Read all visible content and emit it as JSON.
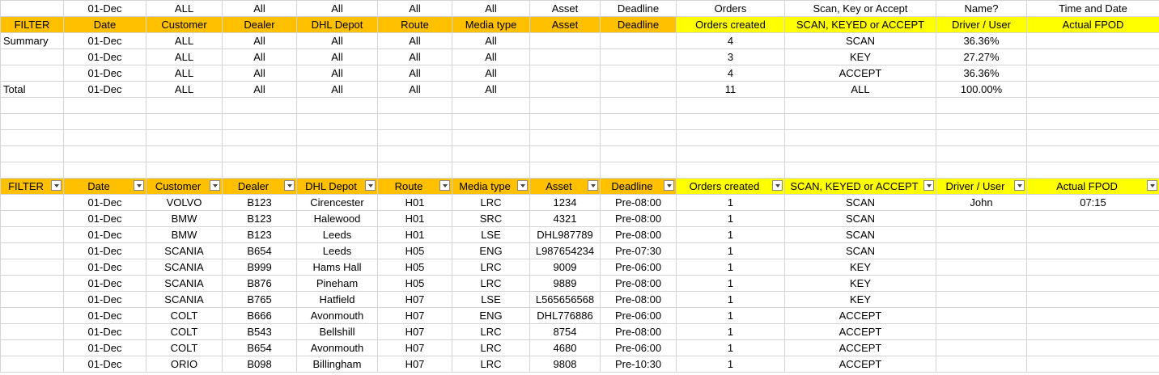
{
  "filter_row": [
    "",
    "01-Dec",
    "ALL",
    "All",
    "All",
    "All",
    "All",
    "Asset",
    "Deadline",
    "Orders",
    "Scan, Key or Accept",
    "Name?",
    "Time and Date"
  ],
  "header": [
    "FILTER",
    "Date",
    "Customer",
    "Dealer",
    "DHL Depot",
    "Route",
    "Media type",
    "Asset",
    "Deadline",
    "Orders created",
    "SCAN, KEYED or ACCEPT",
    "Driver / User",
    "Actual FPOD"
  ],
  "summary_rows": [
    [
      "Summary",
      "01-Dec",
      "ALL",
      "All",
      "All",
      "All",
      "All",
      "",
      "",
      "4",
      "SCAN",
      "36.36%",
      ""
    ],
    [
      "",
      "01-Dec",
      "ALL",
      "All",
      "All",
      "All",
      "All",
      "",
      "",
      "3",
      "KEY",
      "27.27%",
      ""
    ],
    [
      "",
      "01-Dec",
      "ALL",
      "All",
      "All",
      "All",
      "All",
      "",
      "",
      "4",
      "ACCEPT",
      "36.36%",
      ""
    ],
    [
      "Total",
      "01-Dec",
      "ALL",
      "All",
      "All",
      "All",
      "All",
      "",
      "",
      "11",
      "ALL",
      "100.00%",
      ""
    ]
  ],
  "table_header": [
    "FILTER",
    "Date",
    "Customer",
    "Dealer",
    "DHL Depot",
    "Route",
    "Media type",
    "Asset",
    "Deadline",
    "Orders created",
    "SCAN, KEYED or ACCEPT",
    "Driver / User",
    "Actual FPOD"
  ],
  "data_rows": [
    [
      "",
      "01-Dec",
      "VOLVO",
      "B123",
      "Cirencester",
      "H01",
      "LRC",
      "1234",
      "Pre-08:00",
      "1",
      "SCAN",
      "John",
      "07:15"
    ],
    [
      "",
      "01-Dec",
      "BMW",
      "B123",
      "Halewood",
      "H01",
      "SRC",
      "4321",
      "Pre-08:00",
      "1",
      "SCAN",
      "",
      ""
    ],
    [
      "",
      "01-Dec",
      "BMW",
      "B123",
      "Leeds",
      "H01",
      "LSE",
      "DHL987789",
      "Pre-08:00",
      "1",
      "SCAN",
      "",
      ""
    ],
    [
      "",
      "01-Dec",
      "SCANIA",
      "B654",
      "Leeds",
      "H05",
      "ENG",
      "L987654234",
      "Pre-07:30",
      "1",
      "SCAN",
      "",
      ""
    ],
    [
      "",
      "01-Dec",
      "SCANIA",
      "B999",
      "Hams Hall",
      "H05",
      "LRC",
      "9009",
      "Pre-06:00",
      "1",
      "KEY",
      "",
      ""
    ],
    [
      "",
      "01-Dec",
      "SCANIA",
      "B876",
      "Pineham",
      "H05",
      "LRC",
      "9889",
      "Pre-08:00",
      "1",
      "KEY",
      "",
      ""
    ],
    [
      "",
      "01-Dec",
      "SCANIA",
      "B765",
      "Hatfield",
      "H07",
      "LSE",
      "L565656568",
      "Pre-08:00",
      "1",
      "KEY",
      "",
      ""
    ],
    [
      "",
      "01-Dec",
      "COLT",
      "B666",
      "Avonmouth",
      "H07",
      "ENG",
      "DHL776886",
      "Pre-06:00",
      "1",
      "ACCEPT",
      "",
      ""
    ],
    [
      "",
      "01-Dec",
      "COLT",
      "B543",
      "Bellshill",
      "H07",
      "LRC",
      "8754",
      "Pre-08:00",
      "1",
      "ACCEPT",
      "",
      ""
    ],
    [
      "",
      "01-Dec",
      "COLT",
      "B654",
      "Avonmouth",
      "H07",
      "LRC",
      "4680",
      "Pre-06:00",
      "1",
      "ACCEPT",
      "",
      ""
    ],
    [
      "",
      "01-Dec",
      "ORIO",
      "B098",
      "Billingham",
      "H07",
      "LRC",
      "9808",
      "Pre-10:30",
      "1",
      "ACCEPT",
      "",
      ""
    ]
  ],
  "colors": {
    "header_orange": "#ffc000",
    "header_yellow": "#ffff00",
    "gridline": "#d4d4d4"
  },
  "icons": {
    "filter_dropdown": "filter-dropdown-icon"
  }
}
